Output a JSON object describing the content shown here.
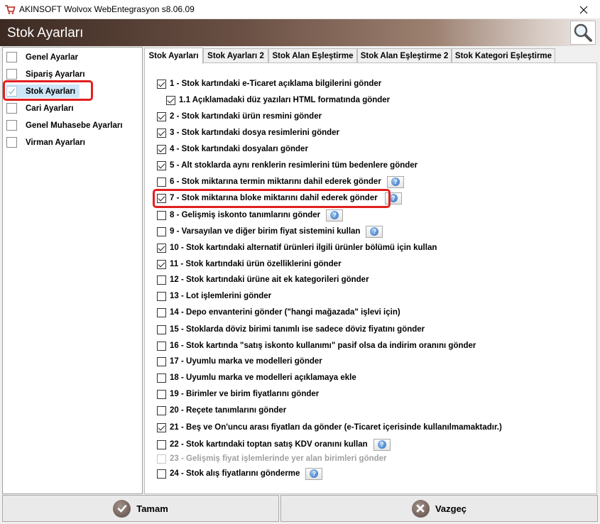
{
  "window": {
    "title": "AKINSOFT Wolvox WebEntegrasyon s8.06.09"
  },
  "header": {
    "title": "Stok Ayarları"
  },
  "sidebar": {
    "items": [
      {
        "label": "Genel Ayarlar",
        "checked": false,
        "active": false
      },
      {
        "label": "Sipariş Ayarları",
        "checked": false,
        "active": false
      },
      {
        "label": "Stok Ayarları",
        "checked": true,
        "active": true
      },
      {
        "label": "Cari Ayarları",
        "checked": false,
        "active": false
      },
      {
        "label": "Genel Muhasebe Ayarları",
        "checked": false,
        "active": false
      },
      {
        "label": "Virman Ayarları",
        "checked": false,
        "active": false
      }
    ]
  },
  "tabs": [
    {
      "label": "Stok Ayarları",
      "active": true
    },
    {
      "label": "Stok Ayarları 2",
      "active": false
    },
    {
      "label": "Stok Alan Eşleştirme",
      "active": false
    },
    {
      "label": "Stok Alan Eşleştirme 2",
      "active": false
    },
    {
      "label": "Stok Kategori Eşleştirme",
      "active": false
    }
  ],
  "options": [
    {
      "label": "1 - Stok kartındaki e-Ticaret açıklama bilgilerini gönder",
      "checked": true,
      "help": false,
      "disabled": false
    },
    {
      "label": "1.1 Açıklamadaki düz yazıları HTML formatında gönder",
      "checked": true,
      "help": false,
      "disabled": false
    },
    {
      "label": "2 - Stok kartındaki ürün resmini gönder",
      "checked": true,
      "help": false,
      "disabled": false
    },
    {
      "label": "3 - Stok kartındaki dosya resimlerini gönder",
      "checked": true,
      "help": false,
      "disabled": false
    },
    {
      "label": "4 - Stok kartındaki dosyaları gönder",
      "checked": true,
      "help": false,
      "disabled": false
    },
    {
      "label": "5 - Alt stoklarda aynı renklerin resimlerini tüm bedenlere gönder",
      "checked": true,
      "help": false,
      "disabled": false
    },
    {
      "label": "6 - Stok miktarına termin miktarını dahil ederek gönder",
      "checked": false,
      "help": true,
      "disabled": false
    },
    {
      "label": "7 - Stok miktarına bloke miktarını dahil ederek gönder",
      "checked": true,
      "help": true,
      "disabled": false
    },
    {
      "label": "8 - Gelişmiş iskonto tanımlarını gönder",
      "checked": false,
      "help": true,
      "disabled": false
    },
    {
      "label": "9 - Varsayılan ve diğer birim fiyat sistemini kullan",
      "checked": false,
      "help": true,
      "disabled": false
    },
    {
      "label": "10 - Stok kartındaki alternatif ürünleri ilgili ürünler bölümü için kullan",
      "checked": true,
      "help": false,
      "disabled": false
    },
    {
      "label": "11 - Stok kartındaki ürün özelliklerini gönder",
      "checked": true,
      "help": false,
      "disabled": false
    },
    {
      "label": "12 - Stok kartındaki ürüne ait ek kategorileri gönder",
      "checked": false,
      "help": false,
      "disabled": false
    },
    {
      "label": "13 - Lot işlemlerini gönder",
      "checked": false,
      "help": false,
      "disabled": false
    },
    {
      "label": "14 - Depo envanterini gönder (\"hangi mağazada\" işlevi için)",
      "checked": false,
      "help": false,
      "disabled": false
    },
    {
      "label": "15 - Stoklarda döviz birimi tanımlı ise sadece döviz fiyatını gönder",
      "checked": false,
      "help": false,
      "disabled": false
    },
    {
      "label": "16 - Stok kartında \"satış iskonto kullanımı\" pasif olsa da indirim oranını gönder",
      "checked": false,
      "help": false,
      "disabled": false
    },
    {
      "label": "17 - Uyumlu marka ve modelleri gönder",
      "checked": false,
      "help": false,
      "disabled": false
    },
    {
      "label": "18 - Uyumlu marka ve modelleri açıklamaya ekle",
      "checked": false,
      "help": false,
      "disabled": false
    },
    {
      "label": "19 - Birimler ve birim fiyatlarını gönder",
      "checked": false,
      "help": false,
      "disabled": false
    },
    {
      "label": "20 - Reçete tanımlarını gönder",
      "checked": false,
      "help": false,
      "disabled": false
    },
    {
      "label": "21 - Beş ve On'uncu arası fiyatları da gönder (e-Ticaret içerisinde kullanılmamaktadır.)",
      "checked": true,
      "help": false,
      "disabled": false
    },
    {
      "label": "22 - Stok kartındaki toptan satış KDV oranını kullan",
      "checked": false,
      "help": true,
      "disabled": false
    },
    {
      "label": "23 - Gelişmiş fiyat işlemlerinde yer alan birimleri gönder",
      "checked": false,
      "help": false,
      "disabled": true
    },
    {
      "label": "24 - Stok alış fiyatlarını gönderme",
      "checked": false,
      "help": true,
      "disabled": false
    }
  ],
  "buttons": {
    "ok": "Tamam",
    "cancel": "Vazgeç"
  },
  "colors": {
    "highlight": "#e21f1f",
    "header_dark": "#3c2a22",
    "selection": "#cde6f7"
  },
  "icons": {
    "help": "help-icon",
    "search": "search-icon",
    "ok": "check-icon",
    "cancel": "cancel-icon"
  }
}
